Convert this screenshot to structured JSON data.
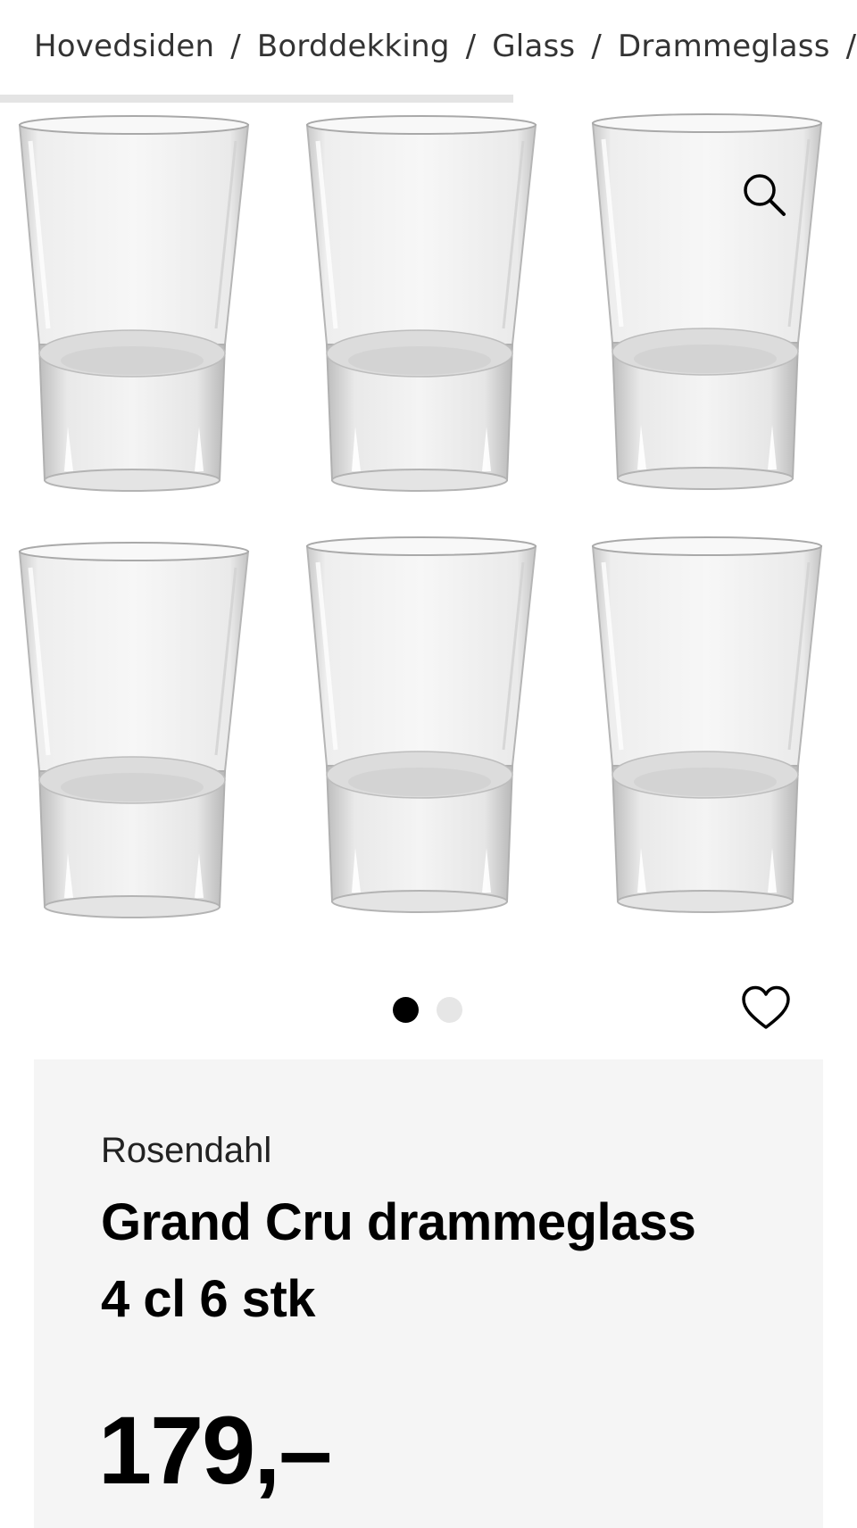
{
  "breadcrumb": [
    {
      "label": "Hovedsiden"
    },
    {
      "label": "Borddekking"
    },
    {
      "label": "Glass"
    },
    {
      "label": "Drammeglass"
    }
  ],
  "breadcrumb_separator": "/",
  "gallery": {
    "slide_count": 2,
    "active_slide": 1,
    "image_subject": "six shot glasses",
    "zoom_icon": "search-icon",
    "favorite_icon": "heart-outline-icon"
  },
  "product": {
    "brand": "Rosendahl",
    "title": "Grand Cru drammeglass 4 cl 6 stk",
    "price": "179,–"
  },
  "colors": {
    "info_background": "#f5f5f5",
    "text": "#000000",
    "dot_active": "#000000",
    "dot_inactive": "#e6e6e6"
  }
}
